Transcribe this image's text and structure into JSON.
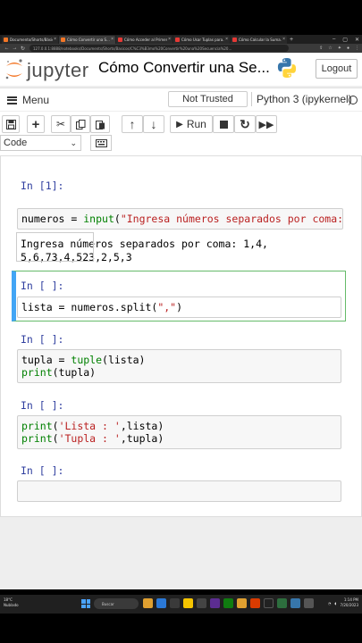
{
  "browser": {
    "tabs": [
      {
        "title": "Documento/Shorts/Básicos",
        "active": false
      },
      {
        "title": "Cómo Convertir una S...",
        "active": true
      },
      {
        "title": "Cómo Acceder al Primer...",
        "active": false
      },
      {
        "title": "Cómo Usar Tuplas para...",
        "active": false
      },
      {
        "title": "Cómo Calcular la Suma...",
        "active": false
      }
    ],
    "url": "127.0.0.1:8888/notebooks/Documents/Shorts/Basicos/C%C3%B3mo%20Convertir%20una%20Secuencia%20..."
  },
  "header": {
    "logo_text": "jupyter",
    "notebook_title": "Cómo Convertir una Se...",
    "logout_label": "Logout"
  },
  "menubar": {
    "menu_label": "Menu",
    "trust_label": "Not Trusted",
    "kernel_label": "Python 3 (ipykernel)"
  },
  "toolbar": {
    "run_label": "Run",
    "cell_type": "Code"
  },
  "cells": [
    {
      "prompt": "In [1]:",
      "code_parts": {
        "a": "numeros = ",
        "b": "input",
        "c": "(",
        "d": "\"Ingresa números separados por coma: \"",
        "e": ")"
      },
      "output_line1": "Ingresa números separados por coma: 1,4,",
      "output_line2": "5,6,73,4,523,2,5,3"
    },
    {
      "prompt": "In [ ]:",
      "code_parts": {
        "a": "lista = numeros.split(",
        "b": "\",\"",
        "c": ")"
      }
    },
    {
      "prompt": "In [ ]:",
      "line1_parts": {
        "a": "tupla = ",
        "b": "tuple",
        "c": "(lista)"
      },
      "line2_parts": {
        "a": "print",
        "b": "(tupla)"
      }
    },
    {
      "prompt": "In [ ]:",
      "line1_parts": {
        "a": "print",
        "b": "(",
        "c": "'Lista : '",
        "d": ",lista)"
      },
      "line2_parts": {
        "a": "print",
        "b": "(",
        "c": "'Tupla : '",
        "d": ",tupla)"
      }
    },
    {
      "prompt": "In [ ]:"
    }
  ],
  "taskbar": {
    "weather_temp": "18°C",
    "weather_desc": "Nublado",
    "search_label": "Buscar",
    "time": "1:14 PM",
    "date": "7/20/2023"
  },
  "colors": {
    "accent_blue": "#42a5f5",
    "selected_green": "#66bb6a",
    "prompt_blue": "#303f9f",
    "keyword_green": "#008000",
    "string_red": "#ba2121",
    "jupyter_orange": "#f37626"
  }
}
